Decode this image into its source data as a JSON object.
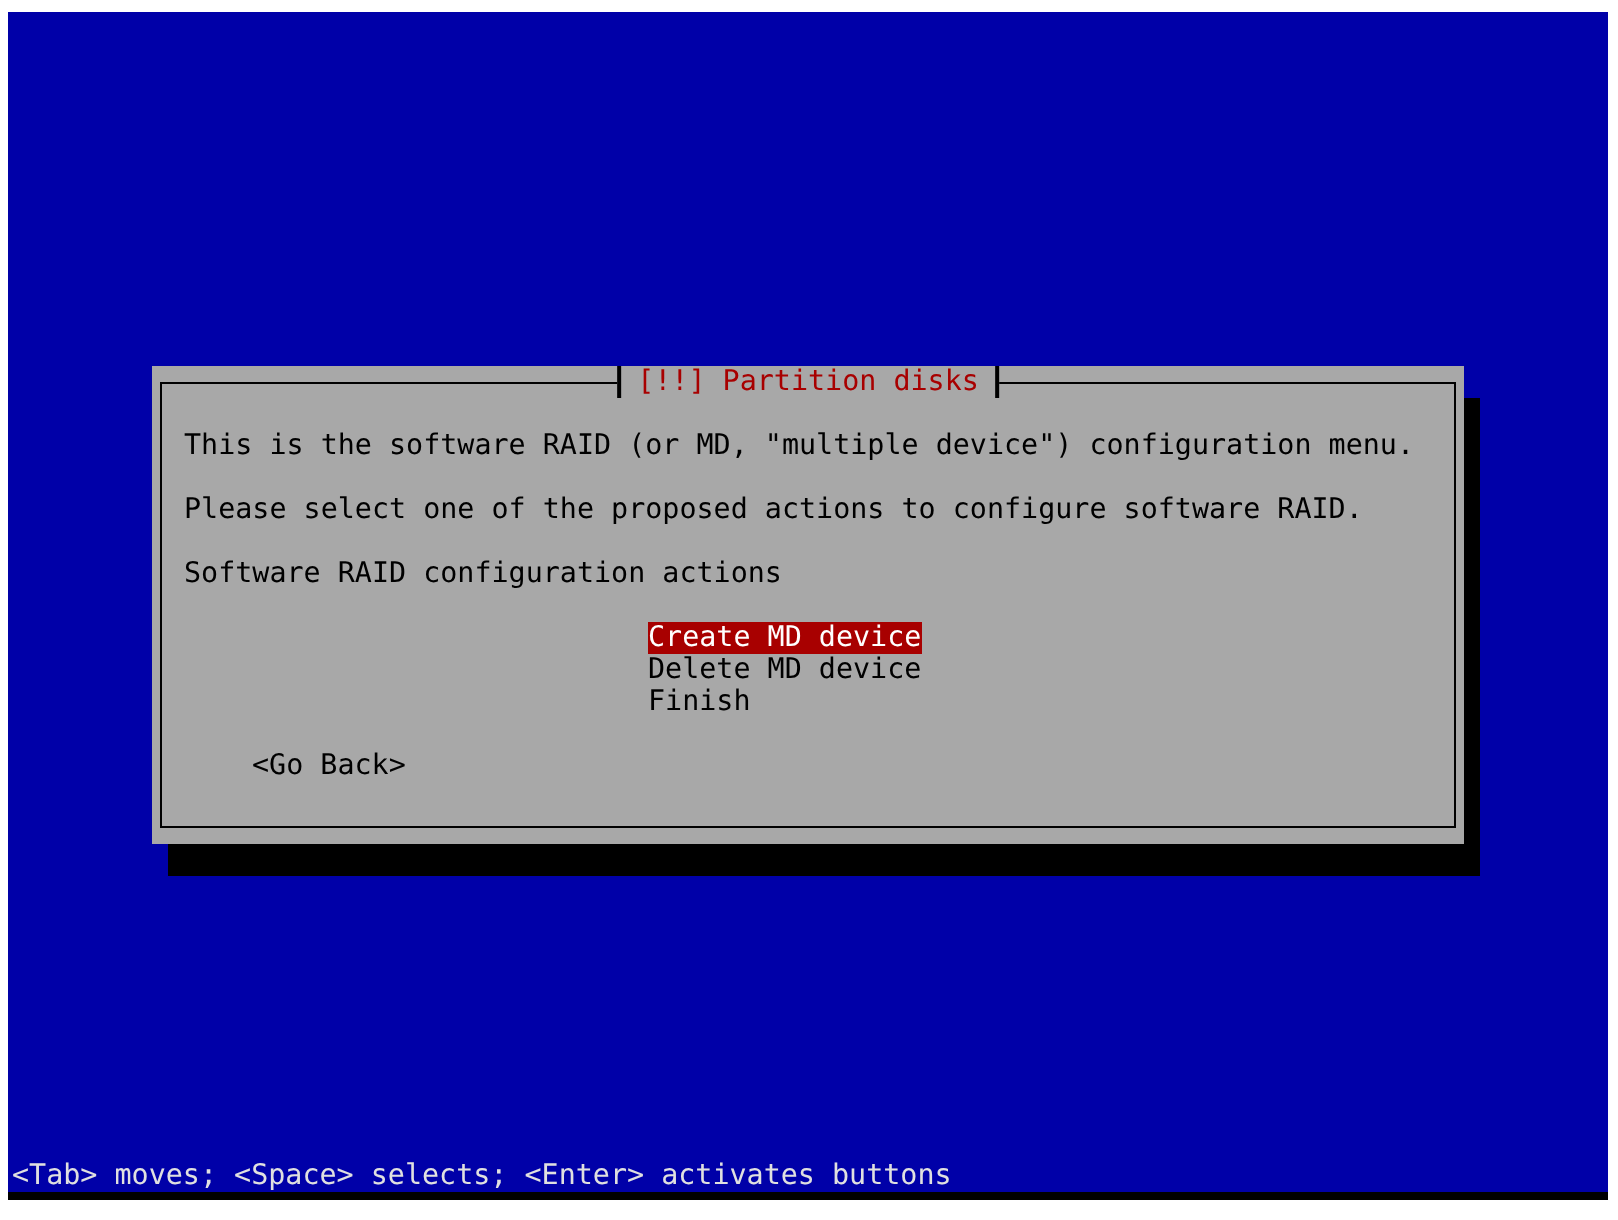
{
  "dialog": {
    "title": "[!!] Partition disks",
    "paragraphs": [
      "This is the software RAID (or MD, \"multiple device\") configuration menu.",
      "Please select one of the proposed actions to configure software RAID.",
      "Software RAID configuration actions"
    ],
    "menu_items": [
      {
        "label": "Create MD device",
        "selected": true
      },
      {
        "label": "Delete MD device",
        "selected": false
      },
      {
        "label": "Finish",
        "selected": false
      }
    ],
    "back_button": "<Go Back>"
  },
  "status_bar": "<Tab> moves; <Space> selects; <Enter> activates buttons"
}
